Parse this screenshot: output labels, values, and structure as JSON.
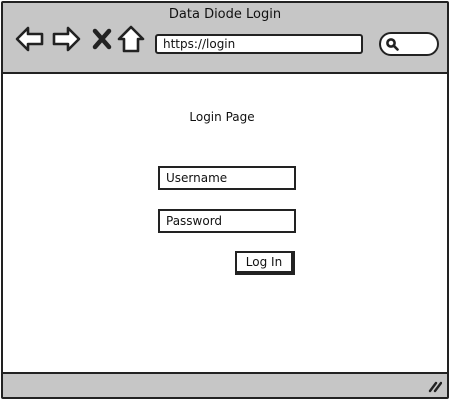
{
  "window": {
    "title": "Data Diode Login"
  },
  "toolbar": {
    "back_icon": "arrow-left-icon",
    "forward_icon": "arrow-right-icon",
    "stop_icon": "close-icon",
    "home_icon": "home-icon",
    "search_icon": "magnifier-icon"
  },
  "address_bar": {
    "url": "https://login"
  },
  "page": {
    "title": "Login Page",
    "username_placeholder": "Username",
    "password_placeholder": "Password",
    "login_label": "Log In"
  },
  "colors": {
    "chrome": "#c6c6c6",
    "outline": "#222222",
    "background": "#ffffff"
  }
}
